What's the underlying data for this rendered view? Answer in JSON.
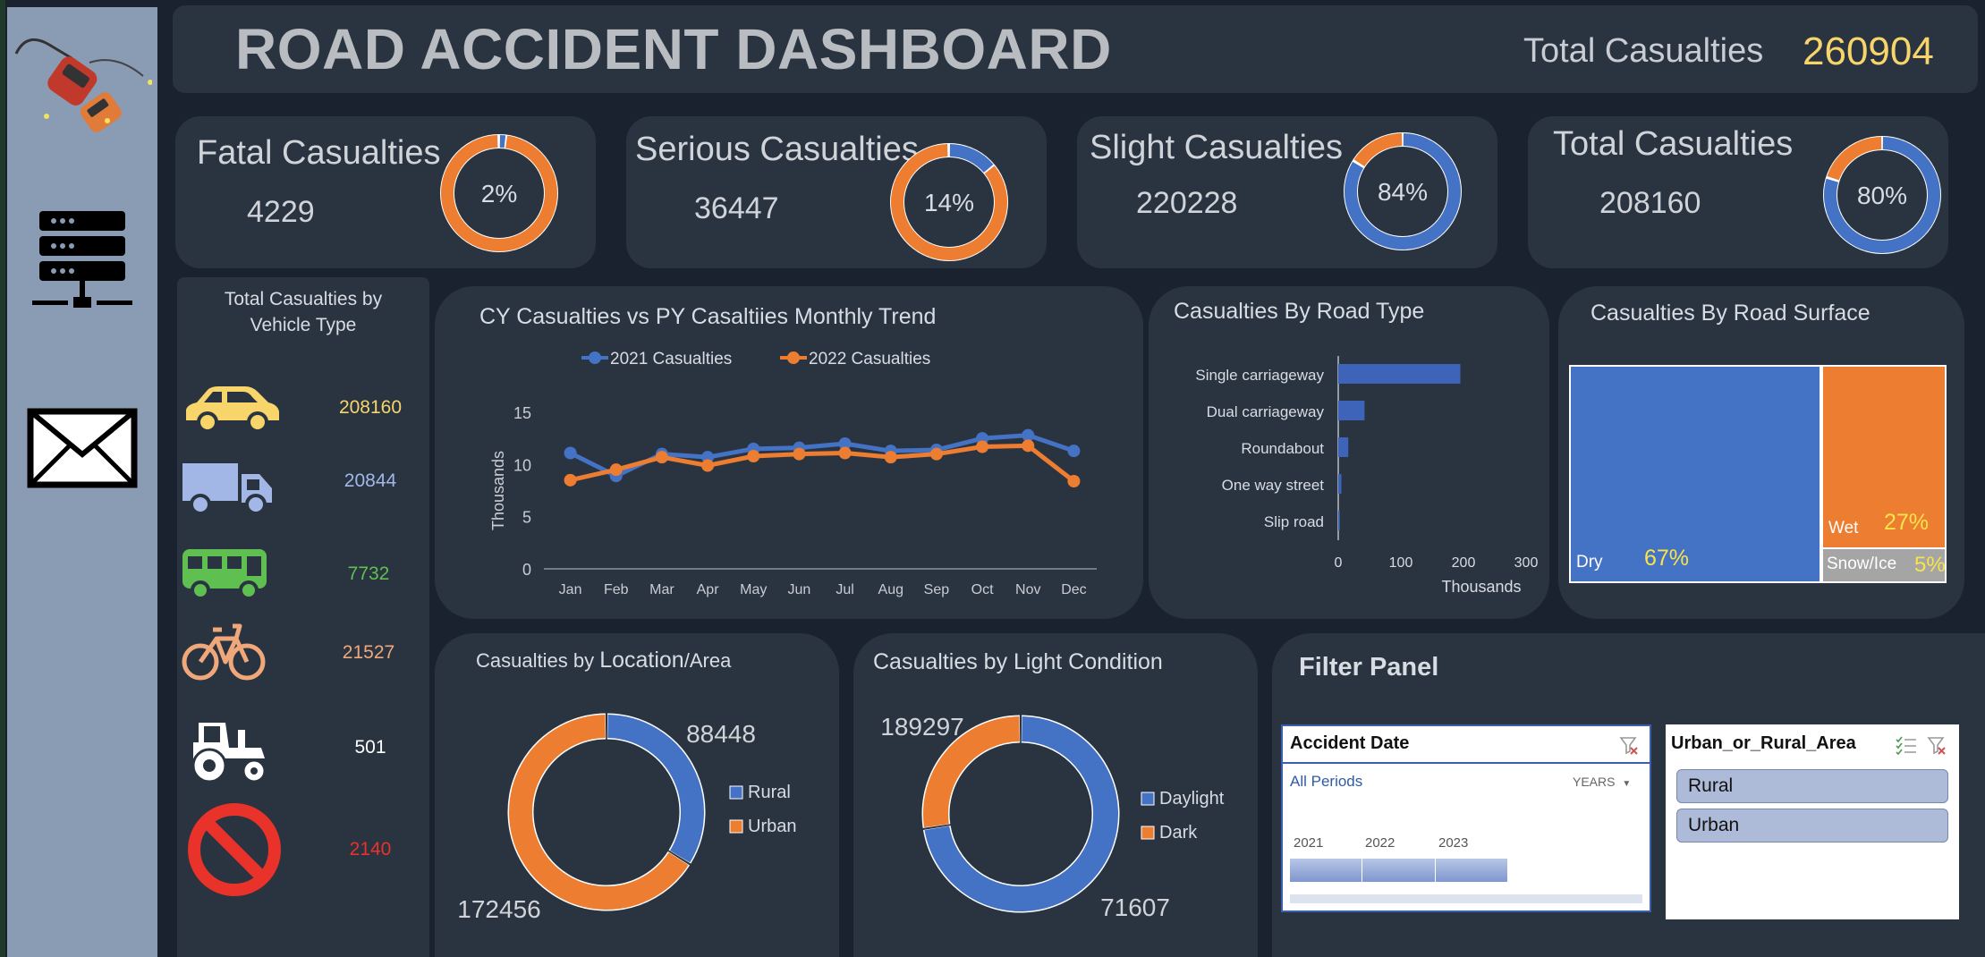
{
  "header": {
    "title": "ROAD ACCIDENT DASHBOARD",
    "total_label": "Total Casualties",
    "total_value": "260904"
  },
  "sidebar": {
    "icons": [
      "car-crash-icon",
      "server-icon",
      "mail-icon"
    ]
  },
  "kpis": [
    {
      "label": "Fatal Casualties",
      "value": "4229",
      "pct_label": "2%",
      "fraction": 0.02,
      "ring": "orange"
    },
    {
      "label": "Serious Casualties",
      "value": "36447",
      "pct_label": "14%",
      "fraction": 0.14,
      "ring": "orange"
    },
    {
      "label": "Slight Casualties",
      "value": "220228",
      "pct_label": "84%",
      "fraction": 0.84,
      "ring": "blue"
    },
    {
      "label": "Total Casualties",
      "value": "208160",
      "pct_label": "80%",
      "fraction": 0.8,
      "ring": "blue"
    }
  ],
  "vehicle_panel": {
    "title_line1": "Total Casualties by",
    "title_line2": "Vehicle Type",
    "items": [
      {
        "icon": "car-icon",
        "value": "208160",
        "color": "#f7d56a"
      },
      {
        "icon": "truck-icon",
        "value": "20844",
        "color": "#a3b7e6"
      },
      {
        "icon": "bus-icon",
        "value": "7732",
        "color": "#5fbf50"
      },
      {
        "icon": "bicycle-icon",
        "value": "21527",
        "color": "#f0a87a"
      },
      {
        "icon": "tractor-icon",
        "value": "501",
        "color": "#ffffff"
      },
      {
        "icon": "prohibited-icon",
        "value": "2140",
        "color": "#e8322a"
      }
    ]
  },
  "colors": {
    "blue": "#4472c4",
    "orange": "#ed7d31",
    "bg_card": "#2a3441",
    "accent_yellow": "#f7d56a"
  },
  "chart_data": [
    {
      "id": "monthly-trend",
      "type": "line",
      "title": "CY Casualties vs PY Casaltied Monthly Trend",
      "title_text": "CY Casualties vs PY Casaltiies Monthly Trend",
      "ylabel": "Thousands",
      "ylim": [
        0,
        15
      ],
      "yticks": [
        "0",
        "5",
        "10",
        "15"
      ],
      "categories": [
        "Jan",
        "Feb",
        "Mar",
        "Apr",
        "May",
        "Jun",
        "Jul",
        "Aug",
        "Sep",
        "Oct",
        "Nov",
        "Dec"
      ],
      "series": [
        {
          "name": "2021 Casualties",
          "color": "#4472c4",
          "values": [
            11.1,
            8.9,
            11.0,
            10.7,
            11.5,
            11.6,
            12.0,
            11.3,
            11.4,
            12.5,
            12.8,
            11.3
          ]
        },
        {
          "name": "2022 Casualties",
          "color": "#ed7d31",
          "values": [
            8.5,
            9.5,
            10.7,
            9.9,
            10.8,
            11.0,
            11.1,
            10.7,
            11.0,
            11.7,
            11.8,
            8.4
          ]
        }
      ]
    },
    {
      "id": "road-type",
      "type": "bar",
      "orientation": "horizontal",
      "title": "Casualties By Road Type",
      "categories": [
        "Single carriageway",
        "Dual carriageway",
        "Roundabout",
        "One way street",
        "Slip road"
      ],
      "values": [
        195,
        42,
        16,
        5,
        2.5
      ],
      "xlabel": "Thousands",
      "xlim": [
        0,
        300
      ],
      "xticks": [
        "0",
        "100",
        "200",
        "300"
      ]
    },
    {
      "id": "road-surface",
      "type": "treemap",
      "title": "Casualties By Road Surface",
      "items": [
        {
          "name": "Dry",
          "pct": "67%",
          "value": 0.67,
          "color": "#4472c4"
        },
        {
          "name": "Wet",
          "pct": "27%",
          "value": 0.27,
          "color": "#ed7d31"
        },
        {
          "name": "Snow/Ice",
          "pct": "5%",
          "value": 0.05,
          "color": "#a5a5a5"
        }
      ]
    },
    {
      "id": "location",
      "type": "pie",
      "title": "Casualties by Location/Area",
      "title_a": "Casualties by ",
      "title_b": "Location",
      "title_c": "/Area",
      "slices": [
        {
          "name": "Rural",
          "value": 88448,
          "label": "88448",
          "color": "#4472c4"
        },
        {
          "name": "Urban",
          "value": 172456,
          "label": "172456",
          "color": "#ed7d31"
        }
      ]
    },
    {
      "id": "light",
      "type": "pie",
      "title": "Casualties by Light Condition",
      "slices": [
        {
          "name": "Daylight",
          "value": 189297,
          "label": "189297",
          "color": "#4472c4"
        },
        {
          "name": "Dark",
          "value": 71607,
          "label": "71607",
          "color": "#ed7d31"
        }
      ]
    }
  ],
  "filter_panel": {
    "title": "Filter Panel",
    "date_slicer": {
      "title": "Accident Date",
      "selection": "All Periods",
      "level": "YEARS",
      "years": [
        "2021",
        "2022",
        "2023"
      ]
    },
    "area_slicer": {
      "title": "Urban_or_Rural_Area",
      "items": [
        "Rural",
        "Urban"
      ]
    }
  }
}
